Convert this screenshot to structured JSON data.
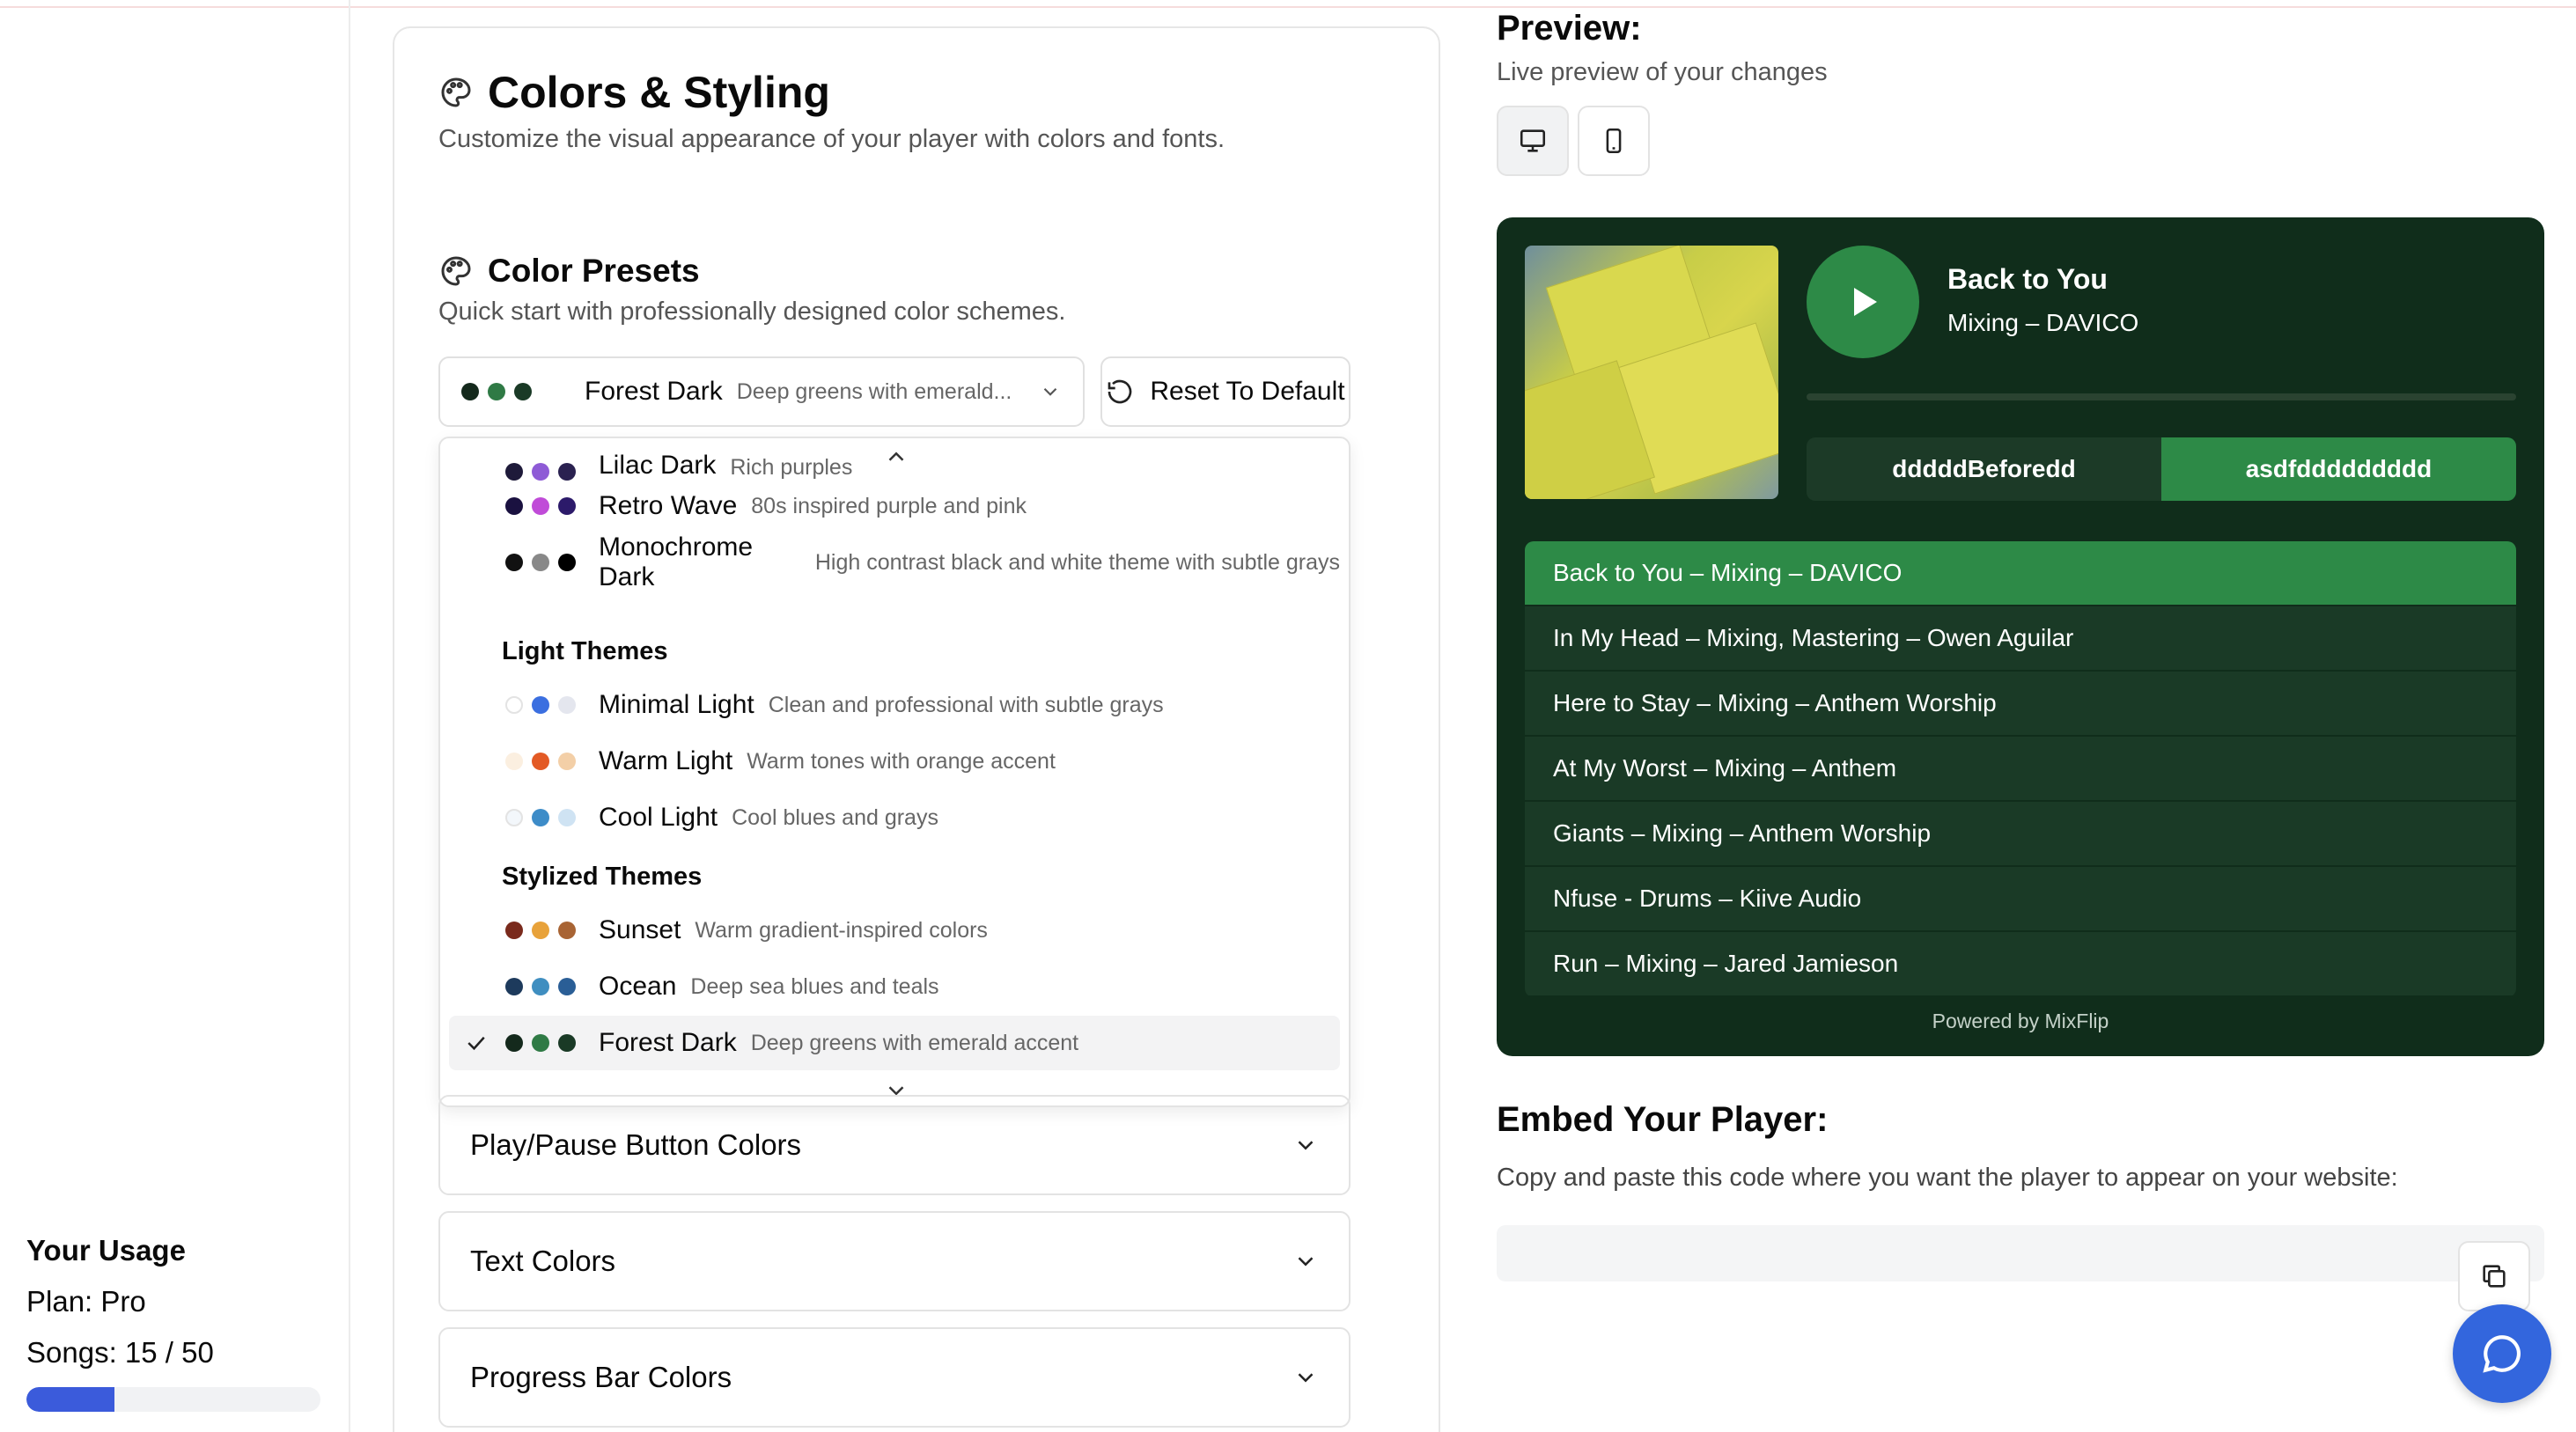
{
  "sidebar": {
    "usage_title": "Your Usage",
    "plan": "Plan: Pro",
    "songs": "Songs: 15 / 50",
    "songs_used": 15,
    "songs_limit": 50,
    "bar_color": "#3b5bdb"
  },
  "styling": {
    "title": "Colors & Styling",
    "subtitle": "Customize the visual appearance of your player with colors and fonts.",
    "presets_title": "Color Presets",
    "presets_subtitle": "Quick start with professionally designed color schemes.",
    "selected_preset": {
      "name": "Forest Dark",
      "desc": "Deep greens with emerald...",
      "colors": [
        "#14291c",
        "#2f7a45",
        "#1a3a26"
      ]
    },
    "reset_label": "Reset To Default",
    "dropdown": {
      "partial_item": {
        "name": "Lilac Dark",
        "desc": "Rich purples",
        "colors": [
          "#1e1a3a",
          "#8e5bd6",
          "#2a2150"
        ]
      },
      "dark_items": [
        {
          "name": "Retro Wave",
          "desc": "80s inspired purple and pink",
          "colors": [
            "#1a1140",
            "#c04bd8",
            "#2c1a6a"
          ]
        },
        {
          "name": "Monochrome Dark",
          "desc": "High contrast black and white theme with subtle grays",
          "colors": [
            "#111111",
            "#888888",
            "#000000"
          ]
        }
      ],
      "light_group": "Light Themes",
      "light_items": [
        {
          "name": "Minimal Light",
          "desc": "Clean and professional with subtle grays",
          "colors": [
            "#ffffff",
            "#3b6fe0",
            "#e4e6ee"
          ]
        },
        {
          "name": "Warm Light",
          "desc": "Warm tones with orange accent",
          "colors": [
            "#fbefe0",
            "#e35a25",
            "#f3cfa7"
          ]
        },
        {
          "name": "Cool Light",
          "desc": "Cool blues and grays",
          "colors": [
            "#f3f7fb",
            "#3d8cc8",
            "#cfe3f3"
          ]
        }
      ],
      "stylized_group": "Stylized Themes",
      "stylized_items": [
        {
          "name": "Sunset",
          "desc": "Warm gradient-inspired colors",
          "colors": [
            "#7a2a1c",
            "#e8a23a",
            "#a86434"
          ]
        },
        {
          "name": "Ocean",
          "desc": "Deep sea blues and teals",
          "colors": [
            "#1d3a5c",
            "#3f8ec0",
            "#2a5e96"
          ]
        },
        {
          "name": "Forest Dark",
          "desc": "Deep greens with emerald accent",
          "colors": [
            "#14291c",
            "#2f7a45",
            "#1a3a26"
          ]
        }
      ]
    },
    "accordions": [
      "Play/Pause Button Colors",
      "Text Colors",
      "Progress Bar Colors"
    ]
  },
  "preview": {
    "title": "Preview:",
    "subtitle": "Live preview of your changes",
    "icons": [
      "desktop-icon",
      "mobile-icon"
    ],
    "player": {
      "bg_color": "#102d1b",
      "accent_color": "#2d8a47",
      "track_title": "Back to You",
      "track_sub": "Mixing – DAVICO",
      "toggle_left": "dddddBeforedd",
      "toggle_right": "asdfddddddddd",
      "playlist": [
        "Back to You – Mixing – DAVICO",
        "In My Head – Mixing, Mastering – Owen Aguilar",
        "Here to Stay – Mixing – Anthem Worship",
        "At My Worst – Mixing – Anthem",
        "Giants – Mixing – Anthem Worship",
        "Nfuse - Drums – Kiive Audio",
        "Run – Mixing – Jared Jamieson"
      ],
      "powered_by": "Powered by MixFlip"
    }
  },
  "embed": {
    "title": "Embed Your Player:",
    "subtitle": "Copy and paste this code where you want the player to appear on your website:",
    "code": ""
  }
}
